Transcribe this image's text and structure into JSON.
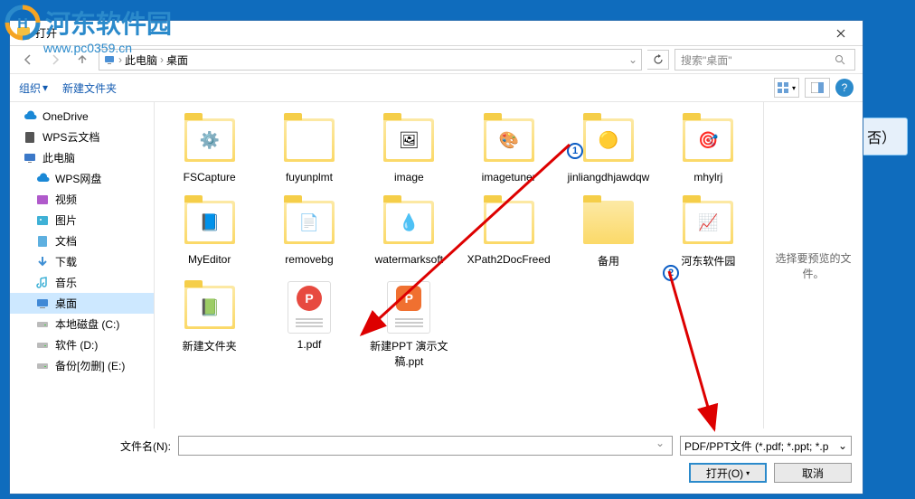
{
  "watermark": {
    "brand": "河东软件园",
    "url": "www.pc0359.cn"
  },
  "background": {
    "button_fragment": "否）"
  },
  "titlebar": {
    "title": "打开"
  },
  "breadcrumb": {
    "root": "此电脑",
    "current": "桌面"
  },
  "search": {
    "placeholder": "搜索\"桌面\""
  },
  "toolbar": {
    "organize": "组织",
    "new_folder": "新建文件夹"
  },
  "sidebar": {
    "items": [
      {
        "label": "OneDrive",
        "icon": "cloud",
        "color": "#1a88d6"
      },
      {
        "label": "WPS云文档",
        "icon": "doc",
        "color": "#555"
      },
      {
        "label": "此电脑",
        "icon": "pc",
        "color": "#3b78c8",
        "bold": true
      },
      {
        "label": "WPS网盘",
        "icon": "cloud",
        "color": "#1a88d6",
        "sub": true
      },
      {
        "label": "视频",
        "icon": "video",
        "color": "#b05acb",
        "sub": true
      },
      {
        "label": "图片",
        "icon": "image",
        "color": "#3fb1d6",
        "sub": true
      },
      {
        "label": "文档",
        "icon": "doc",
        "color": "#5eb0e0",
        "sub": true
      },
      {
        "label": "下载",
        "icon": "download",
        "color": "#3f8fd4",
        "sub": true
      },
      {
        "label": "音乐",
        "icon": "music",
        "color": "#3fb1d6",
        "sub": true
      },
      {
        "label": "桌面",
        "icon": "desktop",
        "color": "#4189d6",
        "sub": true,
        "active": true
      },
      {
        "label": "本地磁盘 (C:)",
        "icon": "disk",
        "sub": true
      },
      {
        "label": "软件 (D:)",
        "icon": "disk",
        "sub": true
      },
      {
        "label": "备份[勿删] (E:)",
        "icon": "disk",
        "sub": true
      }
    ]
  },
  "files": {
    "row1": [
      {
        "name": "FSCapture",
        "type": "folder",
        "preview": "⚙️"
      },
      {
        "name": "fuyunplmt",
        "type": "folder"
      },
      {
        "name": "image",
        "type": "folder",
        "preview": "🖼"
      },
      {
        "name": "imagetuner",
        "type": "folder",
        "preview": "🎨"
      },
      {
        "name": "jinliangdhjawdqw",
        "type": "folder",
        "preview": "🟡"
      },
      {
        "name": "mhylrj",
        "type": "folder",
        "preview": "🎯"
      }
    ],
    "row2": [
      {
        "name": "MyEditor",
        "type": "folder",
        "preview": "📘"
      },
      {
        "name": "removebg",
        "type": "folder",
        "preview": "📄"
      },
      {
        "name": "watermarksoft",
        "type": "folder",
        "preview": "💧"
      },
      {
        "name": "XPath2DocFreed",
        "type": "folder"
      },
      {
        "name": "备用",
        "type": "folder-empty"
      },
      {
        "name": "河东软件园",
        "type": "folder",
        "preview": "📈"
      }
    ],
    "row3": [
      {
        "name": "新建文件夹",
        "type": "folder",
        "preview": "📗"
      },
      {
        "name": "1.pdf",
        "type": "pdf"
      },
      {
        "name": "新建PPT 演示文稿.ppt",
        "type": "ppt"
      }
    ]
  },
  "preview": {
    "empty_text": "选择要预览的文件。"
  },
  "footer": {
    "filename_label": "文件名(N):",
    "filetype": "PDF/PPT文件 (*.pdf; *.ppt; *.p",
    "open": "打开(O)",
    "cancel": "取消"
  },
  "annotations": {
    "badge1": "1",
    "badge2": "2"
  }
}
